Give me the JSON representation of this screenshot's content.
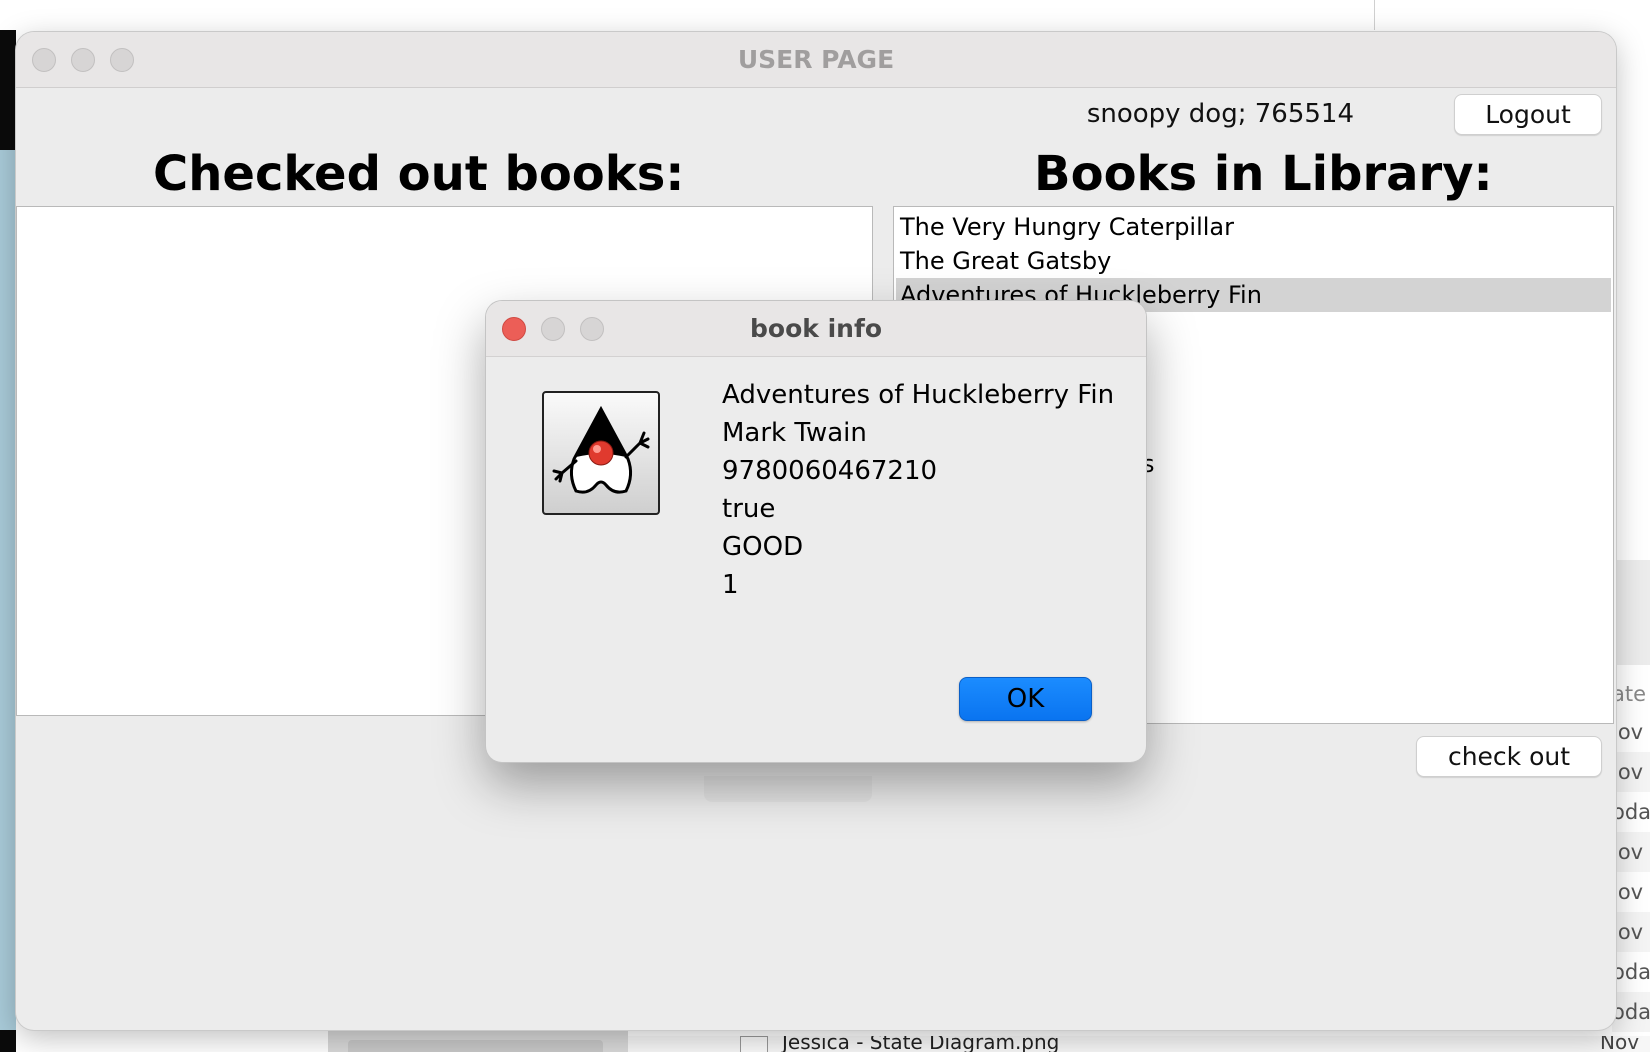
{
  "window": {
    "title": "USER PAGE",
    "user_info": "snoopy dog; 765514",
    "logout_label": "Logout",
    "checked_out_heading": "Checked out books:",
    "library_heading": "Books in Library:",
    "checkout_label": "check out",
    "library_books": [
      "The Very Hungry Caterpillar",
      "The Great Gatsby",
      "Adventures of Huckleberry Fin"
    ],
    "selected_book": "Adventures of Huckleberry Fin",
    "partial_text": "s"
  },
  "dialog": {
    "title": "book info",
    "icon": "java-duke-icon",
    "info": {
      "title": "Adventures of Huckleberry Fin",
      "author": "Mark Twain",
      "isbn": "9780060467210",
      "available": "true",
      "condition": "GOOD",
      "copies": "1"
    },
    "ok_label": "OK"
  },
  "background": {
    "finder_header": "ate",
    "finder_rows": [
      "lov",
      "lov",
      "oda",
      "lov",
      "lov",
      "lov",
      "oda",
      "oda"
    ],
    "finder_bottom_name": "Jessica - State Diagram.png",
    "finder_bottom_date": "Nov"
  },
  "colors": {
    "close_red": "#ec5e57",
    "ok_blue": "#0a74f0",
    "window_bg": "#ececec",
    "selection": "#d3d3d3"
  }
}
